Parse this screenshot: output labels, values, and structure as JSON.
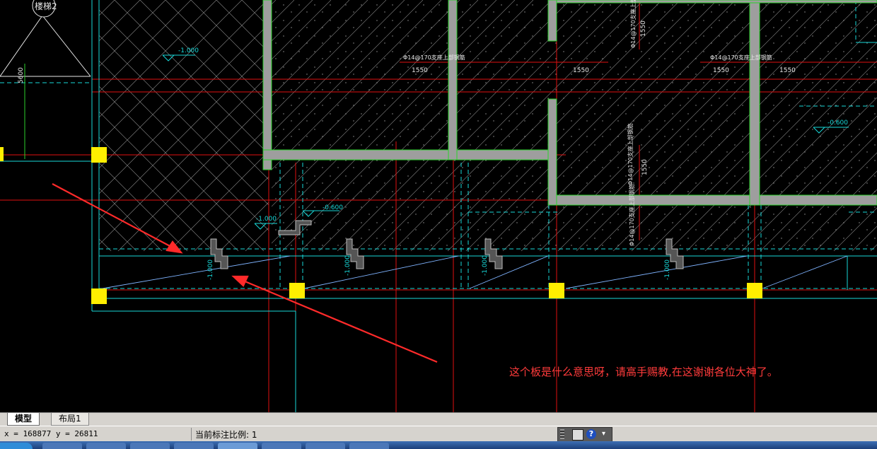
{
  "drawing": {
    "elevations": [
      "-1.000",
      "-0.600",
      "-1.000",
      "-0.600",
      "-1.000",
      "-1.000",
      "-1.000",
      "-1.000"
    ],
    "dimensions": [
      "1550",
      "1550",
      "1550",
      "1550",
      "1550",
      "1550",
      "5600"
    ],
    "rebar_notes": [
      "Φ14@170支座上部钢筋",
      "Φ14@170支座上部钢筋",
      "Φ14@170支座上部钢筋",
      "Φ14@170支座上部钢筋",
      "Φ14@170支座上部钢筋"
    ],
    "stair_label": "楼梯2"
  },
  "annotation": {
    "question": "这个板是什么意思呀，请高手赐教,在这谢谢各位大神了。"
  },
  "tabs": {
    "model": "模型",
    "layout1": "布局1"
  },
  "status": {
    "coords": "x = 168877 y = 26811",
    "scale": "当前标注比例: 1"
  },
  "colors": {
    "background": "#000000",
    "annotation_red": "#ff3b3b",
    "column_yellow": "#ffee00",
    "wall_gray": "#9e9e9e",
    "wall_edge_green": "#2bd12b",
    "axis_red": "#e01010",
    "slab_cyan": "#17d9d9"
  }
}
